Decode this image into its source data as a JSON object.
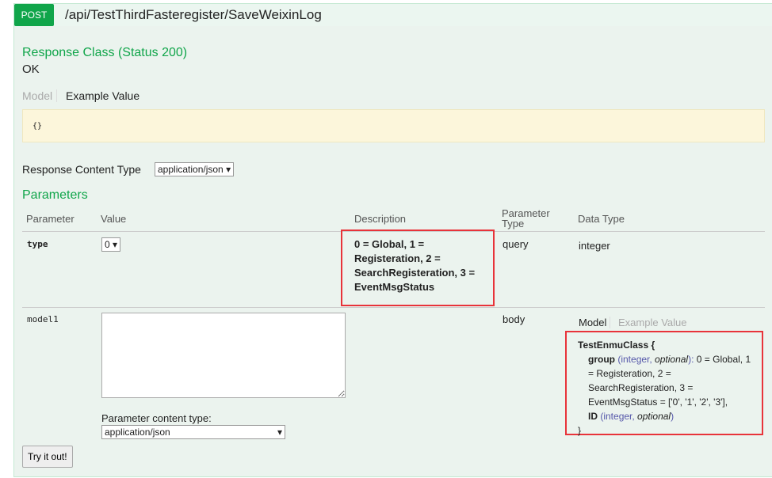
{
  "endpoint": {
    "method": "POST",
    "path": "/api/TestThirdFasteregister/SaveWeixinLog"
  },
  "response": {
    "title": "Response Class (Status 200)",
    "status_text": "OK",
    "tab_model": "Model",
    "tab_example": "Example Value",
    "example": "{}",
    "content_type_label": "Response Content Type",
    "content_type": "application/json"
  },
  "parameters": {
    "title": "Parameters",
    "headers": {
      "parameter": "Parameter",
      "value": "Value",
      "description": "Description",
      "param_type": "Parameter Type",
      "data_type": "Data Type"
    },
    "rows": [
      {
        "name": "type",
        "value": "0",
        "description": "0 = Global, 1 = Registeration, 2 = SearchRegisteration, 3 = EventMsgStatus",
        "param_type": "query",
        "data_type": "integer"
      },
      {
        "name": "model1",
        "value": "",
        "param_type": "body",
        "content_type_label": "Parameter content type:",
        "content_type": "application/json",
        "model_tab": "Model",
        "example_tab": "Example Value",
        "model": {
          "class": "TestEnmuClass {",
          "group": "group",
          "group_type": "(integer, ",
          "optional": "optional",
          "group_close": "):",
          "group_desc": " 0 = Global, 1 = Registeration, 2 = SearchRegisteration, 3 = EventMsgStatus = ['0', '1', '2', '3'],",
          "id": "ID",
          "id_type": "(integer, ",
          "id_close": ")",
          "end": "}"
        }
      }
    ]
  },
  "try_button": "Try it out!"
}
